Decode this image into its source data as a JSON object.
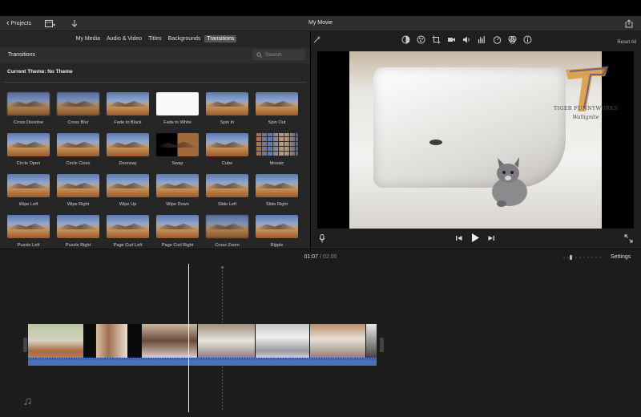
{
  "header": {
    "back_label": "Projects",
    "title": "My Movie"
  },
  "browser": {
    "tabs": [
      "My Media",
      "Audio & Video",
      "Titles",
      "Backgrounds",
      "Transitions"
    ],
    "active_tab": "Transitions",
    "section_title": "Transitions",
    "search_placeholder": "Search",
    "theme_label": "Current Theme: No Theme",
    "items": [
      "Cross Dissolve",
      "Cross Blur",
      "Fade to Black",
      "Fade to White",
      "Spin In",
      "Spin Out",
      "Circle Open",
      "Circle Close",
      "Doorway",
      "Swap",
      "Cube",
      "Mosaic",
      "Wipe Left",
      "Wipe Right",
      "Wipe Up",
      "Wipe Down",
      "Slide Left",
      "Slide Right",
      "Puzzle Left",
      "Puzzle Right",
      "Page Curl Left",
      "Page Curl Right",
      "Cross Zoom",
      "Ripple"
    ]
  },
  "viewer": {
    "reset_label": "Reset All",
    "watermark_line1": "TIGER FUNNYWORKS",
    "watermark_line2": "Wallignite",
    "tool_icons": [
      "enhance-icon",
      "color-balance-icon",
      "crop-icon",
      "stabilization-icon",
      "volume-icon",
      "noise-reduction-icon",
      "speed-icon",
      "filter-icon",
      "info-icon"
    ]
  },
  "timecode": {
    "current": "01:07",
    "separator": " / ",
    "total": "02:00"
  },
  "timeline": {
    "settings_label": "Settings"
  },
  "colors": {
    "accent_audio": "#4a70b8",
    "playhead": "#f0f0f0"
  }
}
